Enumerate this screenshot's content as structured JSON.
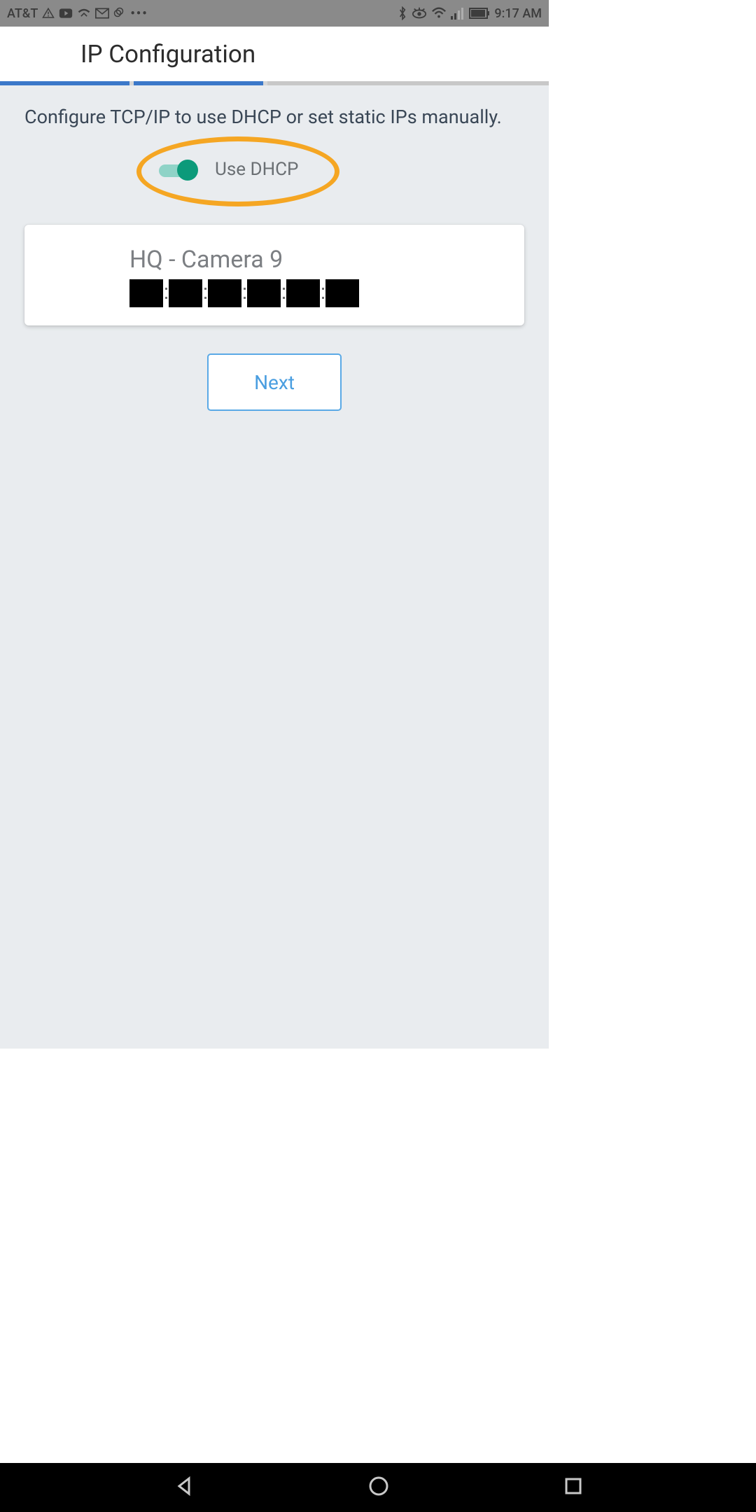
{
  "status_bar": {
    "carrier": "AT&T",
    "time": "9:17 AM",
    "icons_left": [
      "warning-icon",
      "youtube-icon",
      "missed-call-icon",
      "mail-icon",
      "photos-icon",
      "more-icon"
    ],
    "icons_right": [
      "bluetooth-icon",
      "eye-icon",
      "wifi-icon",
      "signal-icon",
      "battery-icon"
    ]
  },
  "header": {
    "title": "IP Configuration"
  },
  "progress": {
    "segments": 3,
    "completed": 2
  },
  "body": {
    "description": "Configure TCP/IP to use DHCP or set static IPs manually.",
    "dhcp_toggle": {
      "label": "Use DHCP",
      "value": true,
      "highlighted": true
    },
    "device_card": {
      "name": "HQ - Camera 9",
      "mac_address_redacted": true,
      "mac_octets": 6
    },
    "next_button": "Next"
  },
  "colors": {
    "accent_blue": "#4a9ee0",
    "progress_blue": "#3b78c9",
    "highlight_orange": "#f5a623",
    "toggle_teal": "#0c9a7a",
    "bg_grey": "#e9ecef"
  }
}
